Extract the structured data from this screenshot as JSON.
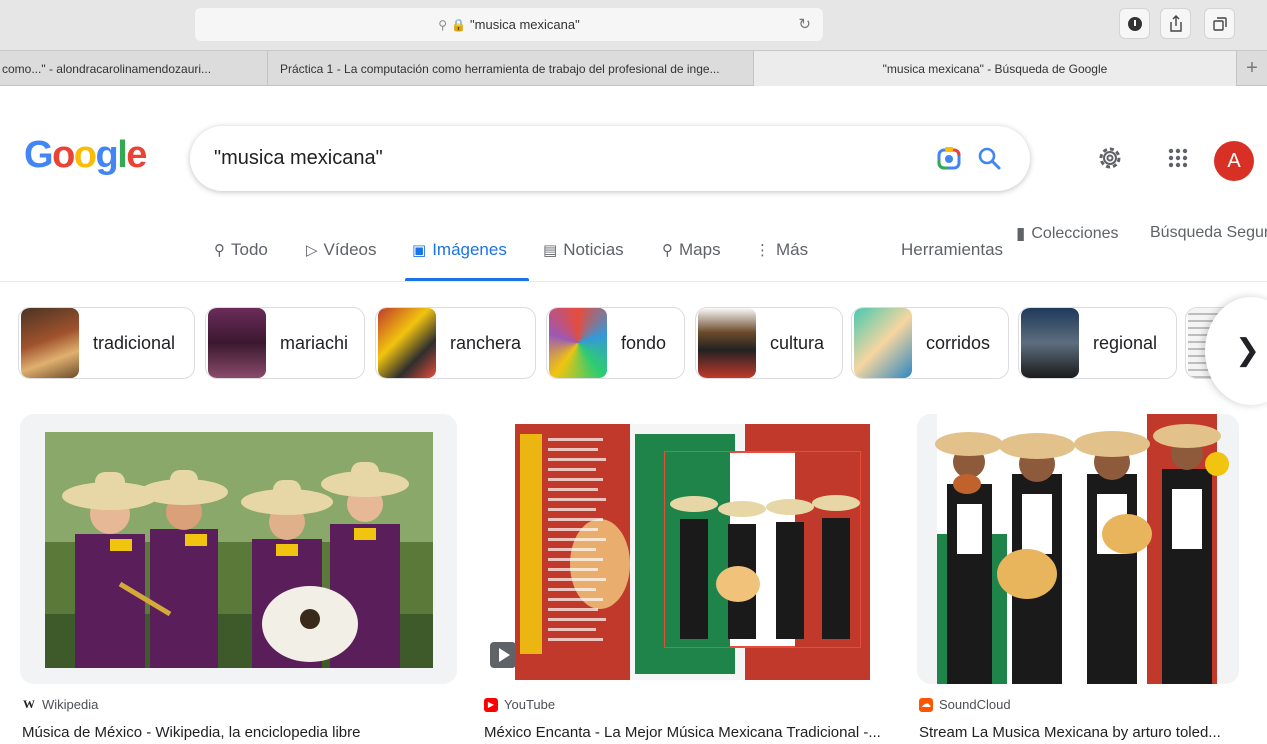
{
  "browser": {
    "url": "\"musica mexicana\"",
    "tabs": [
      {
        "label": "como...\" - alondracarolinamendozauri..."
      },
      {
        "label": "Práctica 1 - La computación como herramienta de trabajo del profesional de inge..."
      },
      {
        "label": "\"musica mexicana\" - Búsqueda de Google"
      }
    ],
    "new_tab": "+"
  },
  "google": {
    "logo_letters": [
      "G",
      "o",
      "o",
      "g",
      "l",
      "e"
    ],
    "logo_colors": [
      "#4285F4",
      "#EA4335",
      "#FBBC05",
      "#4285F4",
      "#34A853",
      "#EA4335"
    ],
    "query": "\"musica mexicana\"",
    "avatar_letter": "A"
  },
  "nav": {
    "todo": "Todo",
    "videos": "Vídeos",
    "imagenes": "Imágenes",
    "noticias": "Noticias",
    "maps": "Maps",
    "mas": "Más",
    "herramientas": "Herramientas",
    "colecciones": "Colecciones",
    "busqueda_segura": "Búsqueda Segura"
  },
  "chips": [
    {
      "label": "tradicional"
    },
    {
      "label": "mariachi"
    },
    {
      "label": "ranchera"
    },
    {
      "label": "fondo"
    },
    {
      "label": "cultura"
    },
    {
      "label": "corridos"
    },
    {
      "label": "regional"
    }
  ],
  "results": [
    {
      "source": "Wikipedia",
      "favicon": "W",
      "title": "Música de México - Wikipedia, la enciclopedia libre"
    },
    {
      "source": "YouTube",
      "favicon": "▶",
      "title": "México Encanta - La Mejor Música Mexicana Tradicional -..."
    },
    {
      "source": "SoundCloud",
      "favicon": "☁",
      "title": "Stream La Musica Mexicana by arturo toled..."
    }
  ],
  "colors": {
    "accent": "#1a73e8",
    "avatar": "#d93025",
    "youtube": "#ff0000",
    "soundcloud": "#ff5500"
  }
}
